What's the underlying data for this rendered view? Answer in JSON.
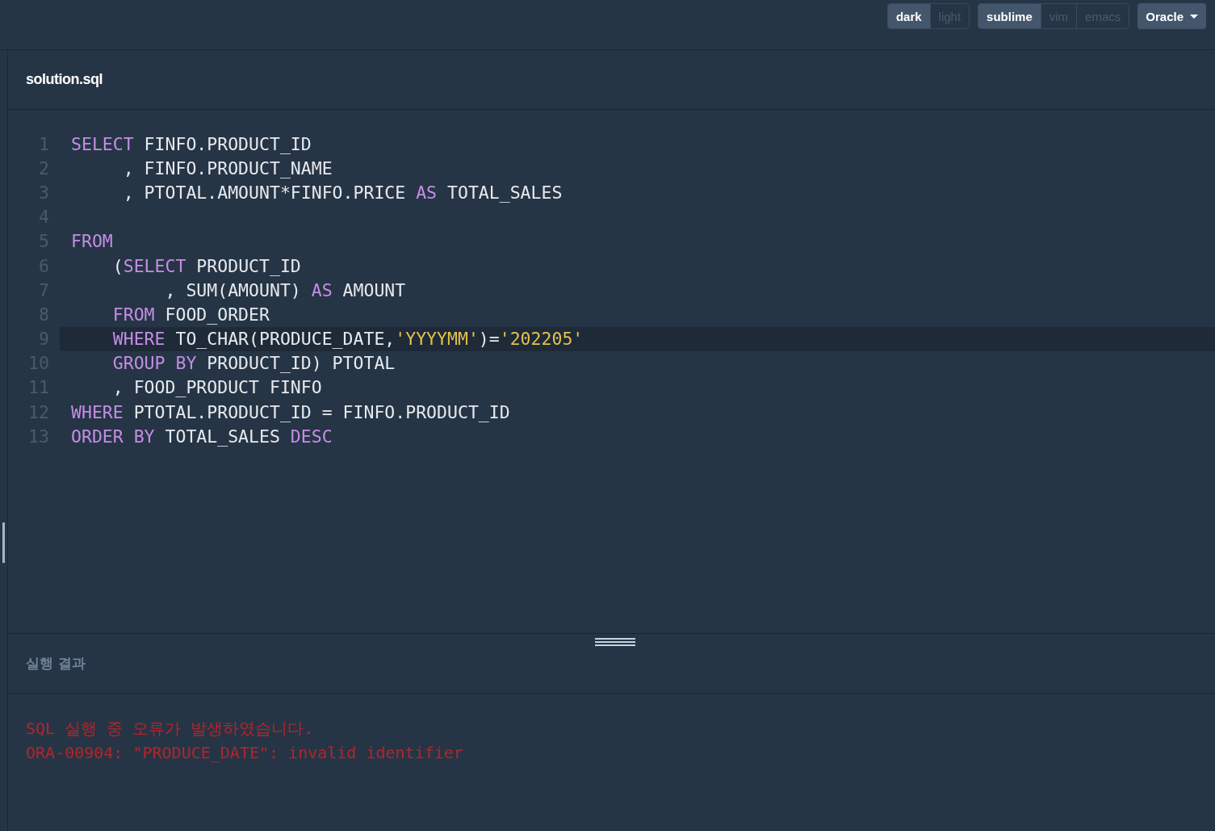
{
  "toolbar": {
    "groups": [
      {
        "items": [
          {
            "label": "dark",
            "selected": true
          },
          {
            "label": "light",
            "selected": false
          }
        ]
      },
      {
        "items": [
          {
            "label": "sublime",
            "selected": true
          },
          {
            "label": "vim",
            "selected": false
          },
          {
            "label": "emacs",
            "selected": false
          }
        ]
      }
    ],
    "dropdown": {
      "label": "Oracle"
    }
  },
  "editor": {
    "filename": "solution.sql",
    "lines": [
      {
        "number": "1",
        "active": false,
        "tokens": [
          {
            "kind": "keyword",
            "text": "SELECT"
          },
          {
            "kind": "plain",
            "text": " FINFO.PRODUCT_ID"
          }
        ]
      },
      {
        "number": "2",
        "active": false,
        "tokens": [
          {
            "kind": "plain",
            "text": "     , FINFO.PRODUCT_NAME"
          }
        ]
      },
      {
        "number": "3",
        "active": false,
        "tokens": [
          {
            "kind": "plain",
            "text": "     , PTOTAL.AMOUNT*FINFO.PRICE "
          },
          {
            "kind": "keyword",
            "text": "AS"
          },
          {
            "kind": "plain",
            "text": " TOTAL_SALES"
          }
        ]
      },
      {
        "number": "4",
        "active": false
      },
      {
        "number": "5",
        "active": false,
        "tokens": [
          {
            "kind": "keyword",
            "text": "FROM"
          }
        ]
      },
      {
        "number": "6",
        "active": false,
        "tokens": [
          {
            "kind": "plain",
            "text": "    ("
          },
          {
            "kind": "keyword",
            "text": "SELECT"
          },
          {
            "kind": "plain",
            "text": " PRODUCT_ID"
          }
        ]
      },
      {
        "number": "7",
        "active": false,
        "tokens": [
          {
            "kind": "plain",
            "text": "         , SUM(AMOUNT) "
          },
          {
            "kind": "keyword",
            "text": "AS"
          },
          {
            "kind": "plain",
            "text": " AMOUNT"
          }
        ]
      },
      {
        "number": "8",
        "active": false,
        "tokens": [
          {
            "kind": "keyword",
            "text": "    FROM"
          },
          {
            "kind": "plain",
            "text": " FOOD_ORDER"
          }
        ]
      },
      {
        "number": "9",
        "active": true,
        "tokens": [
          {
            "kind": "keyword",
            "text": "    WHERE"
          },
          {
            "kind": "plain",
            "text": " TO_CHAR(PRODUCE_DATE,"
          },
          {
            "kind": "string",
            "text": "'YYYYMM'"
          },
          {
            "kind": "plain",
            "text": ")="
          },
          {
            "kind": "string",
            "text": "'202205'"
          }
        ]
      },
      {
        "number": "10",
        "active": false,
        "tokens": [
          {
            "kind": "keyword",
            "text": "    GROUP BY"
          },
          {
            "kind": "plain",
            "text": " PRODUCT_ID) PTOTAL"
          }
        ]
      },
      {
        "number": "11",
        "active": false,
        "tokens": [
          {
            "kind": "plain",
            "text": "    , FOOD_PRODUCT FINFO"
          }
        ]
      },
      {
        "number": "12",
        "active": false,
        "tokens": [
          {
            "kind": "keyword",
            "text": "WHERE"
          },
          {
            "kind": "plain",
            "text": " PTOTAL.PRODUCT_ID = FINFO.PRODUCT_ID"
          }
        ]
      },
      {
        "number": "13",
        "active": false,
        "tokens": [
          {
            "kind": "keyword",
            "text": "ORDER BY"
          },
          {
            "kind": "plain",
            "text": " TOTAL_SALES "
          },
          {
            "kind": "keyword",
            "text": "DESC"
          }
        ]
      }
    ]
  },
  "result": {
    "title": "실행 결과",
    "messages": [
      "SQL 실행 중 오류가 발생하였습니다.",
      "ORA-00904: \"PRODUCE_DATE\": invalid identifier"
    ]
  }
}
